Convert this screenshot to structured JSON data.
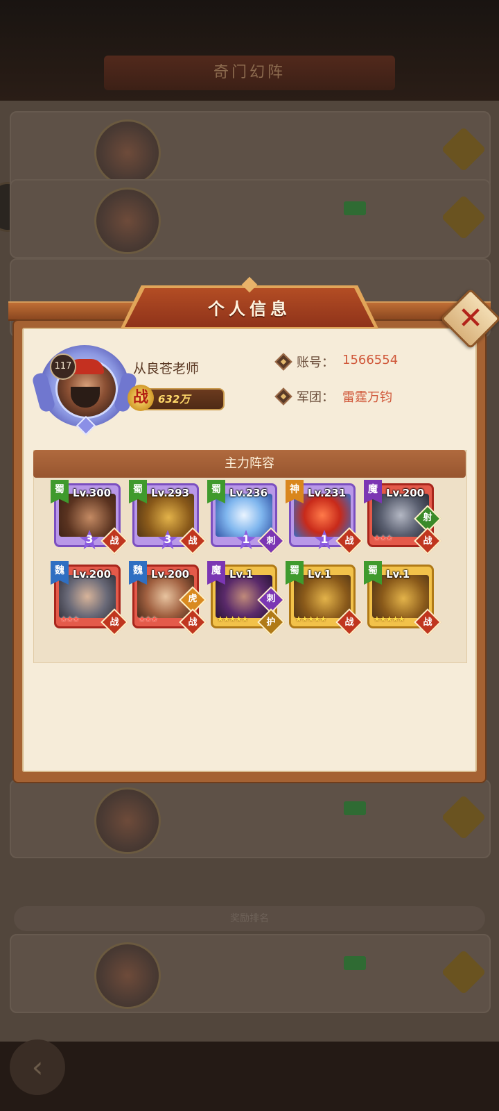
{
  "background": {
    "title": "奇门幻阵",
    "separator": "奖励排名",
    "back_icon": "chevron-left-icon"
  },
  "modal": {
    "title": "个人信息",
    "close_icon": "close-icon"
  },
  "profile": {
    "level": "117",
    "name": "从良苍老师",
    "power_icon_text": "战",
    "power": "632万",
    "account_label": "账号：",
    "account_value": "1566554",
    "legion_label": "军团：",
    "legion_value": "雷霆万钧"
  },
  "lineup": {
    "title": "主力阵容",
    "heroes": [
      {
        "faction": "蜀",
        "level": "Lv.300",
        "star_badge": "3",
        "role": "战",
        "frame": "purple"
      },
      {
        "faction": "蜀",
        "level": "Lv.293",
        "star_badge": "3",
        "role": "战",
        "frame": "purple"
      },
      {
        "faction": "蜀",
        "level": "Lv.236",
        "star_badge": "1",
        "role": "刺",
        "frame": "purple"
      },
      {
        "faction": "神",
        "level": "Lv.231",
        "star_badge": "1",
        "role": "战",
        "frame": "purple"
      },
      {
        "faction": "魔",
        "level": "Lv.200",
        "stars": "★★★",
        "role": "战",
        "sub_role": "射",
        "frame": "red"
      },
      {
        "faction": "魏",
        "level": "Lv.200",
        "stars": "★★★",
        "role": "战",
        "frame": "red"
      },
      {
        "faction": "魏",
        "level": "Lv.200",
        "stars": "★★★",
        "role": "战",
        "sub_role": "虎",
        "frame": "red"
      },
      {
        "faction": "魔",
        "level": "Lv.1",
        "stars": "★★★★★",
        "role": "护",
        "sub_role": "刺",
        "frame": "gold"
      },
      {
        "faction": "蜀",
        "level": "Lv.1",
        "stars": "★★★★★",
        "role": "战",
        "frame": "gold"
      },
      {
        "faction": "蜀",
        "level": "Lv.1",
        "stars": "★★★★★",
        "role": "战",
        "frame": "gold"
      }
    ]
  },
  "colors": {
    "modal_frame": "#a56233",
    "panel_bg": "#f6ecd9",
    "accent_value": "#d0583a",
    "header_red": "#b34d24"
  }
}
